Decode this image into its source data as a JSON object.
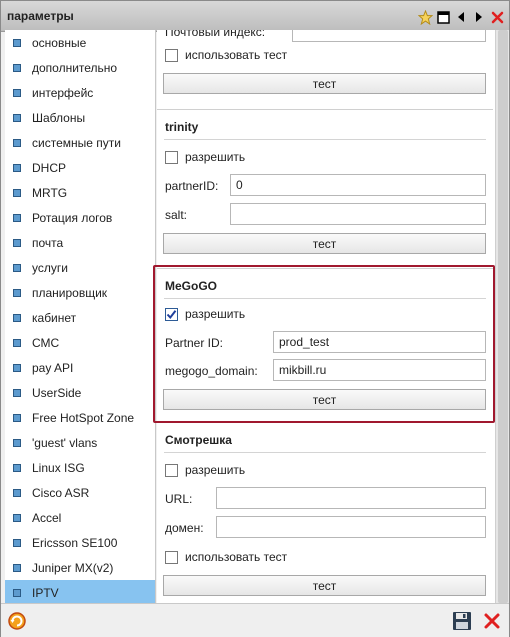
{
  "window": {
    "title": "параметры"
  },
  "sidebar": {
    "items": [
      {
        "label": "основные"
      },
      {
        "label": "дополнительно"
      },
      {
        "label": "интерфейс"
      },
      {
        "label": "Шаблоны"
      },
      {
        "label": "системные пути"
      },
      {
        "label": "DHCP"
      },
      {
        "label": "MRTG"
      },
      {
        "label": "Ротация логов"
      },
      {
        "label": "почта"
      },
      {
        "label": "услуги"
      },
      {
        "label": "планировщик"
      },
      {
        "label": "кабинет"
      },
      {
        "label": "СМС"
      },
      {
        "label": "pay API"
      },
      {
        "label": "UserSide"
      },
      {
        "label": "Free HotSpot Zone"
      },
      {
        "label": "'guest' vlans"
      },
      {
        "label": "Linux ISG"
      },
      {
        "label": "Cisco ASR"
      },
      {
        "label": "Accel"
      },
      {
        "label": "Ericsson SE100"
      },
      {
        "label": "Juniper MX(v2)"
      },
      {
        "label": "IPTV"
      }
    ],
    "active": "IPTV"
  },
  "content": {
    "top": {
      "partial_label": "Почтовый индекс:",
      "use_test_label": "использовать тест",
      "test_button": "тест"
    },
    "trinity": {
      "title": "trinity",
      "enable_label": "разрешить",
      "partner_id_label": "partnerID:",
      "partner_id_value": "0",
      "salt_label": "salt:",
      "salt_value": "",
      "test_button": "тест"
    },
    "megogo": {
      "title": "MeGoGO",
      "enable_label": "разрешить",
      "enabled": true,
      "partner_id_label": "Partner ID:",
      "partner_id_value": "prod_test",
      "domain_label": "megogo_domain:",
      "domain_value": "mikbill.ru",
      "test_button": "тест"
    },
    "smotreshka": {
      "title": "Смотрешка",
      "enable_label": "разрешить",
      "url_label": "URL:",
      "url_value": "",
      "domain_label": "домен:",
      "domain_value": "",
      "use_test_label": "использовать тест",
      "test_button": "тест"
    }
  },
  "colors": {
    "highlight": "#a0182e",
    "active_item": "#87c3f0",
    "bullet": "#5d9bcf"
  },
  "icons": {
    "title_buttons": [
      "star-icon",
      "maximize-icon",
      "prev-icon",
      "next-icon",
      "close-icon"
    ],
    "footer": [
      "refresh-icon",
      "save-icon",
      "cancel-icon"
    ]
  }
}
